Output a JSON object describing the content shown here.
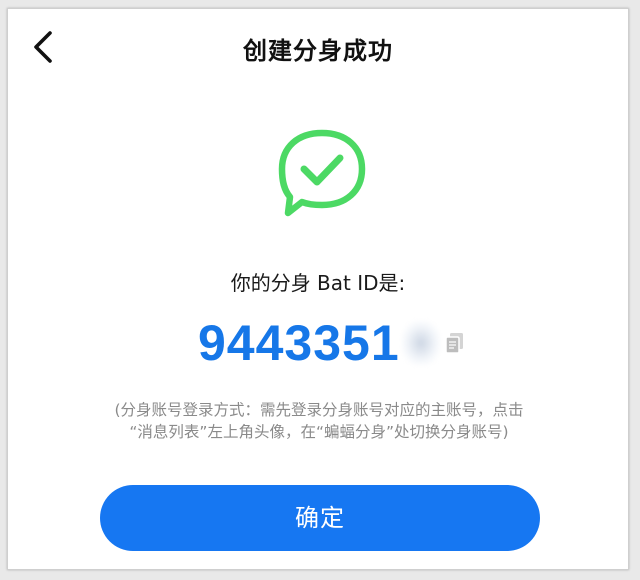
{
  "header": {
    "title": "创建分身成功",
    "back_icon": "chevron-left-icon"
  },
  "status": {
    "icon": "chat-bubble-checkmark-icon",
    "icon_color": "#4cd964"
  },
  "id_section": {
    "caption": "你的分身 Bat ID是:",
    "id_value": "9443351",
    "id_color": "#1677e8",
    "copy_icon": "copy-icon"
  },
  "hint": {
    "line1": "(分身账号登录方式：需先登录分身账号对应的主账号，点击",
    "line2": "“消息列表”左上角头像，在“蝙蝠分身”处切换分身账号)"
  },
  "actions": {
    "confirm_label": "确定",
    "confirm_color": "#1677f2"
  }
}
